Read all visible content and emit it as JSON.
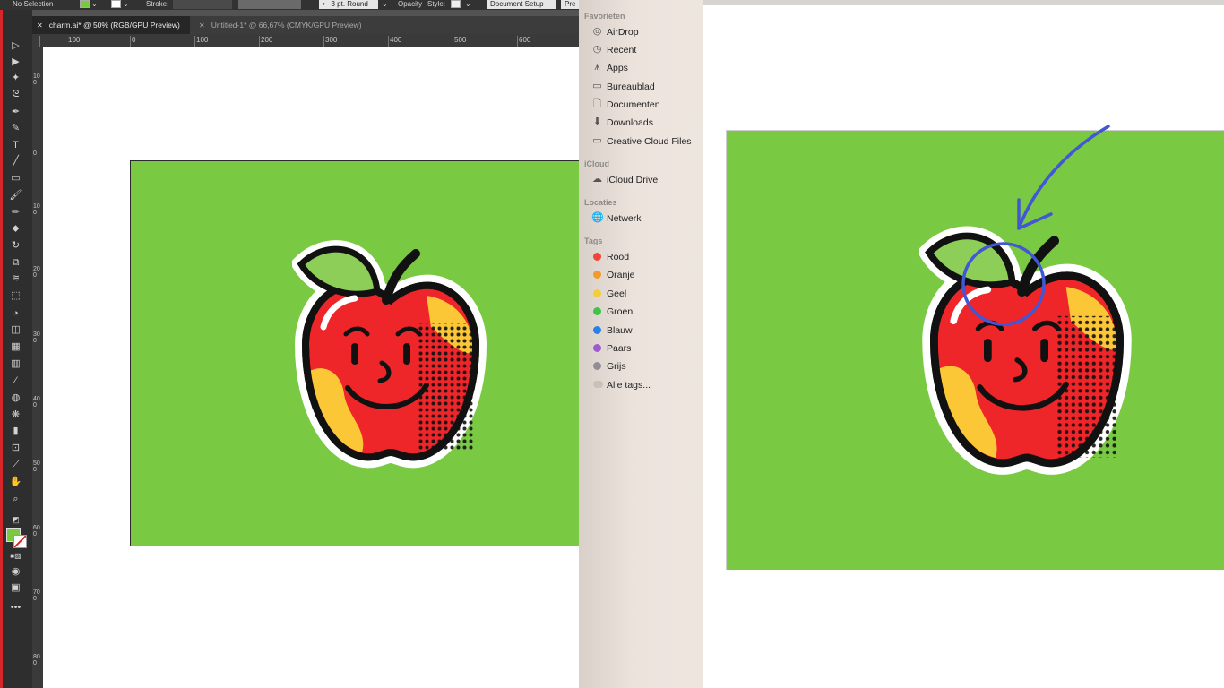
{
  "illustrator": {
    "control_bar": {
      "selection": "No Selection",
      "stroke_label": "Stroke:",
      "stroke_width": "3 pt. Round",
      "opacity_label": "Opacity",
      "style_label": "Style:",
      "document_setup": "Document Setup",
      "preferences": "Pre"
    },
    "tabs": [
      {
        "label": "charm.ai* @ 50% (RGB/GPU Preview)",
        "active": true
      },
      {
        "label": "Untitled-1* @ 66,67% (CMYK/GPU Preview)",
        "active": false
      }
    ],
    "ruler_h": [
      "100",
      "0",
      "100",
      "200",
      "300",
      "400",
      "500",
      "600"
    ],
    "ruler_v": [
      "100",
      "0",
      "100",
      "200",
      "300",
      "400",
      "500",
      "600",
      "700",
      "800"
    ],
    "artboard_color": "#7ac943",
    "fill_color": "#7ac943",
    "ui_accent": "#d6262a"
  },
  "finder": {
    "sections": [
      {
        "title": "Favorieten",
        "items": [
          {
            "label": "AirDrop",
            "icon": "airdrop-icon"
          },
          {
            "label": "Recent",
            "icon": "clock-icon"
          },
          {
            "label": "Apps",
            "icon": "apps-icon"
          },
          {
            "label": "Bureaublad",
            "icon": "desktop-icon"
          },
          {
            "label": "Documenten",
            "icon": "document-icon"
          },
          {
            "label": "Downloads",
            "icon": "download-icon"
          },
          {
            "label": "Creative Cloud Files",
            "icon": "folder-icon"
          }
        ]
      },
      {
        "title": "iCloud",
        "items": [
          {
            "label": "iCloud Drive",
            "icon": "cloud-icon"
          }
        ]
      },
      {
        "title": "Locaties",
        "items": [
          {
            "label": "Netwerk",
            "icon": "globe-icon"
          }
        ]
      },
      {
        "title": "Tags",
        "items": [
          {
            "label": "Rood",
            "color": "#f0453a"
          },
          {
            "label": "Oranje",
            "color": "#f39a2b"
          },
          {
            "label": "Geel",
            "color": "#f5cd3a"
          },
          {
            "label": "Groen",
            "color": "#3fc34b"
          },
          {
            "label": "Blauw",
            "color": "#2c7fe6"
          },
          {
            "label": "Paars",
            "color": "#9d5bd0"
          },
          {
            "label": "Grijs",
            "color": "#8e8e93"
          },
          {
            "label": "Alle tags...",
            "color": "#c8c2b8"
          }
        ]
      }
    ]
  },
  "preview": {
    "artboard_color": "#7ac943",
    "annotation_color": "#4256d6"
  }
}
